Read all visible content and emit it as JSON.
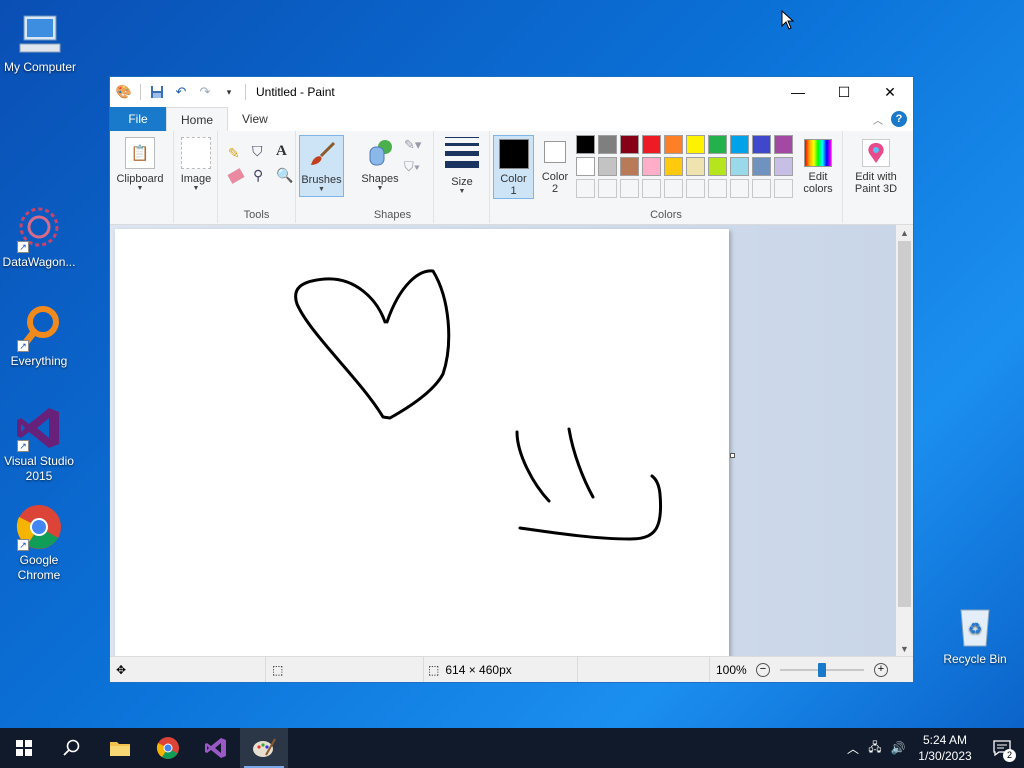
{
  "desktop": {
    "icons": [
      {
        "label": "My Computer"
      },
      {
        "label": "DataWagon..."
      },
      {
        "label": "Everything"
      },
      {
        "label": "Visual Studio 2015"
      },
      {
        "label": "Google Chrome"
      },
      {
        "label": "Recycle Bin"
      }
    ]
  },
  "window": {
    "title": "Untitled - Paint",
    "tabs": [
      {
        "label": "File"
      },
      {
        "label": "Home"
      },
      {
        "label": "View"
      }
    ],
    "ribbon": {
      "clipboard_label": "Clipboard",
      "image_label": "Image",
      "tools_group": "Tools",
      "brushes_label": "Brushes",
      "shapes_label": "Shapes",
      "shapes_group": "Shapes",
      "size_label": "Size",
      "color1_label": "Color",
      "color1_num": "1",
      "color2_label": "Color",
      "color2_num": "2",
      "colors_group": "Colors",
      "edit_colors_line1": "Edit",
      "edit_colors_line2": "colors",
      "paint3d_line1": "Edit with",
      "paint3d_line2": "Paint 3D",
      "palette_row1": [
        "#000000",
        "#7f7f7f",
        "#880015",
        "#ed1c24",
        "#ff7f27",
        "#fff200",
        "#22b14c",
        "#00a2e8",
        "#3f48cc",
        "#a349a4"
      ],
      "palette_row2": [
        "#ffffff",
        "#c3c3c3",
        "#b97a57",
        "#ffaec9",
        "#ffc90e",
        "#efe4b0",
        "#b5e61d",
        "#99d9ea",
        "#7092be",
        "#c8bfe7"
      ]
    },
    "status": {
      "dimensions": "614 × 460px",
      "zoom": "100%",
      "zoom_level": 0.5
    }
  },
  "taskbar": {
    "time": "5:24 AM",
    "date": "1/30/2023",
    "notifications": "2"
  },
  "colors": {
    "accent": "#1979ca"
  }
}
